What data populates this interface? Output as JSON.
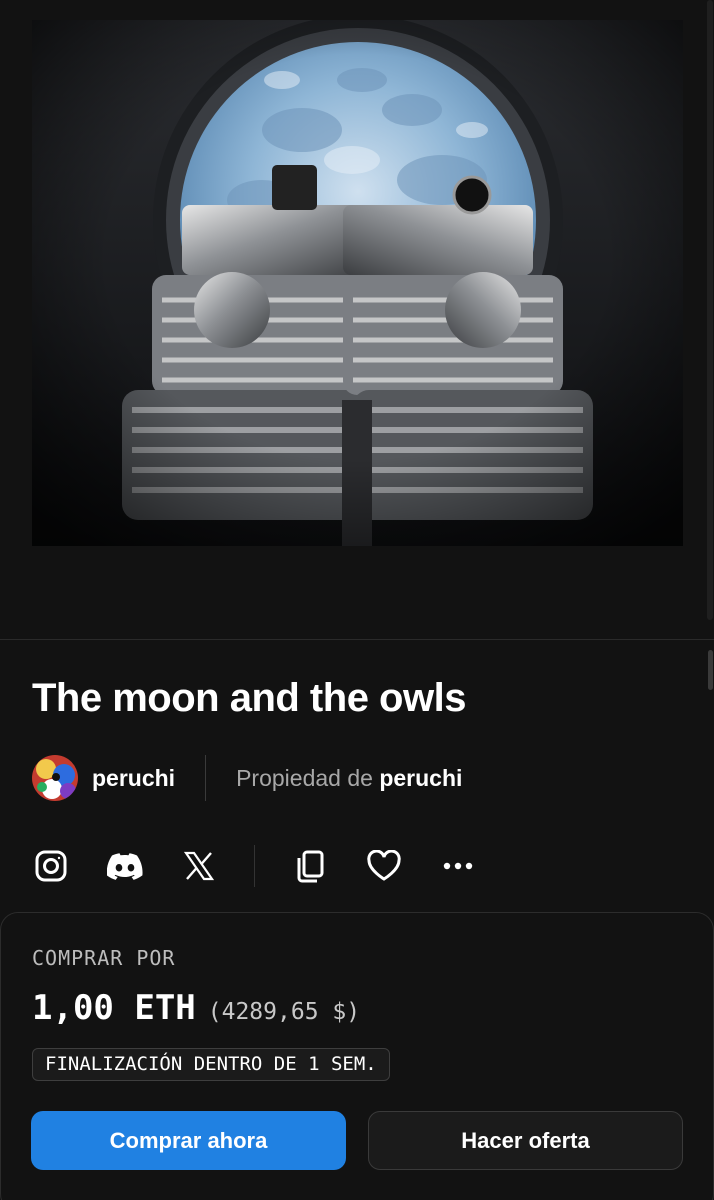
{
  "nft": {
    "title": "The moon and the owls",
    "creator": "peruchi",
    "owned_by_prefix": "Propiedad de",
    "owner": "peruchi"
  },
  "social_icons": [
    "instagram-icon",
    "discord-icon",
    "x-icon",
    "copy-icon",
    "heart-icon",
    "more-icon"
  ],
  "purchase": {
    "label": "COMPRAR POR",
    "price": "1,00 ETH",
    "price_usd": "(4289,65 $)",
    "ends": "FINALIZACIÓN DENTRO DE 1 SEM.",
    "buy_now": "Comprar ahora",
    "make_offer": "Hacer oferta"
  },
  "colors": {
    "background": "#121212",
    "primary_button": "#2081e2",
    "secondary_button": "#1b1b1b"
  }
}
